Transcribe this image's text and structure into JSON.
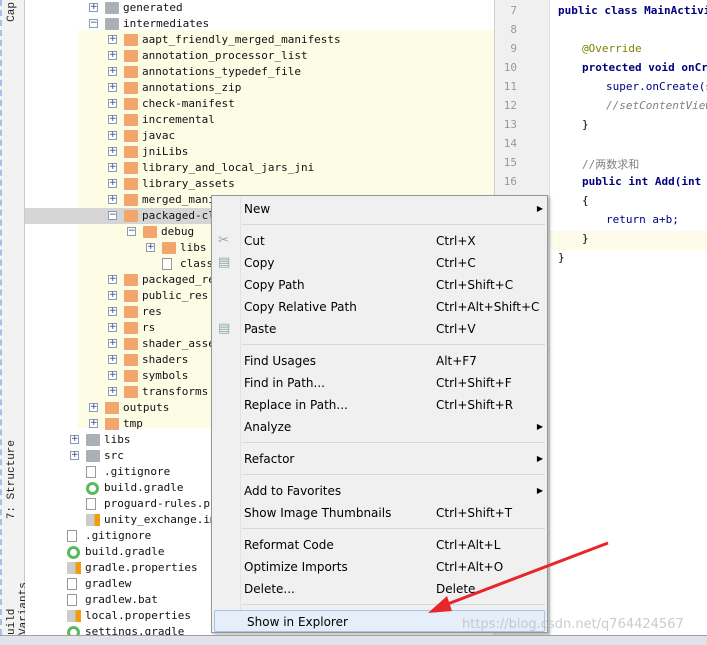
{
  "toolbar_strip": {
    "top_label": "Cap",
    "structure_label": "7: Structure",
    "variants_label": "uild Variants"
  },
  "tree": {
    "selected_index": 13,
    "highlight_color": "#fdfde6",
    "rows": [
      {
        "text": "generated",
        "level": 0,
        "icon": "folder-gray",
        "exp": "+"
      },
      {
        "text": "intermediates",
        "level": 0,
        "icon": "folder-gray",
        "exp": "-"
      },
      {
        "text": "aapt_friendly_merged_manifests",
        "level": 1,
        "icon": "folder-orange",
        "exp": "+"
      },
      {
        "text": "annotation_processor_list",
        "level": 1,
        "icon": "folder-orange",
        "exp": "+"
      },
      {
        "text": "annotations_typedef_file",
        "level": 1,
        "icon": "folder-orange",
        "exp": "+"
      },
      {
        "text": "annotations_zip",
        "level": 1,
        "icon": "folder-orange",
        "exp": "+"
      },
      {
        "text": "check-manifest",
        "level": 1,
        "icon": "folder-orange",
        "exp": "+"
      },
      {
        "text": "incremental",
        "level": 1,
        "icon": "folder-orange",
        "exp": "+"
      },
      {
        "text": "javac",
        "level": 1,
        "icon": "folder-orange",
        "exp": "+"
      },
      {
        "text": "jniLibs",
        "level": 1,
        "icon": "folder-orange",
        "exp": "+"
      },
      {
        "text": "library_and_local_jars_jni",
        "level": 1,
        "icon": "folder-orange",
        "exp": "+"
      },
      {
        "text": "library_assets",
        "level": 1,
        "icon": "folder-orange",
        "exp": "+"
      },
      {
        "text": "merged_mani",
        "level": 1,
        "icon": "folder-orange",
        "exp": "+"
      },
      {
        "text": "packaged-cl",
        "level": 1,
        "icon": "folder-orange",
        "exp": "-"
      },
      {
        "text": "debug",
        "level": 2,
        "icon": "folder-orange",
        "exp": "-"
      },
      {
        "text": "libs",
        "level": 3,
        "icon": "folder-orange",
        "exp": "+"
      },
      {
        "text": "class",
        "level": 3,
        "icon": "file",
        "exp": ""
      },
      {
        "text": "packaged_re",
        "level": 1,
        "icon": "folder-orange",
        "exp": "+"
      },
      {
        "text": "public_res",
        "level": 1,
        "icon": "folder-orange",
        "exp": "+"
      },
      {
        "text": "res",
        "level": 1,
        "icon": "folder-orange",
        "exp": "+"
      },
      {
        "text": "rs",
        "level": 1,
        "icon": "folder-orange",
        "exp": "+"
      },
      {
        "text": "shader_asse",
        "level": 1,
        "icon": "folder-orange",
        "exp": "+"
      },
      {
        "text": "shaders",
        "level": 1,
        "icon": "folder-orange",
        "exp": "+"
      },
      {
        "text": "symbols",
        "level": 1,
        "icon": "folder-orange",
        "exp": "+"
      },
      {
        "text": "transforms",
        "level": 1,
        "icon": "folder-orange",
        "exp": "+"
      },
      {
        "text": "outputs",
        "level": 0,
        "icon": "folder-orange",
        "exp": "+"
      },
      {
        "text": "tmp",
        "level": 0,
        "icon": "folder-orange",
        "exp": "+"
      },
      {
        "text": "libs",
        "level": -1,
        "icon": "folder-gray",
        "exp": "+"
      },
      {
        "text": "src",
        "level": -1,
        "icon": "folder-gray",
        "exp": "+"
      },
      {
        "text": ".gitignore",
        "level": -1,
        "icon": "file",
        "exp": ""
      },
      {
        "text": "build.gradle",
        "level": -1,
        "icon": "gradle",
        "exp": ""
      },
      {
        "text": "proguard-rules.pro",
        "level": -1,
        "icon": "file",
        "exp": ""
      },
      {
        "text": "unity_exchange.iml",
        "level": -1,
        "icon": "props",
        "exp": ""
      },
      {
        "text": ".gitignore",
        "level": -2,
        "icon": "file",
        "exp": ""
      },
      {
        "text": "build.gradle",
        "level": -2,
        "icon": "gradle",
        "exp": ""
      },
      {
        "text": "gradle.properties",
        "level": -2,
        "icon": "props",
        "exp": ""
      },
      {
        "text": "gradlew",
        "level": -2,
        "icon": "file",
        "exp": ""
      },
      {
        "text": "gradlew.bat",
        "level": -2,
        "icon": "file",
        "exp": ""
      },
      {
        "text": "local.properties",
        "level": -2,
        "icon": "props",
        "exp": ""
      },
      {
        "text": "settings.gradle",
        "level": -2,
        "icon": "gradle",
        "exp": ""
      }
    ]
  },
  "editor": {
    "lines": [
      {
        "num": "7",
        "indent": 0,
        "text": "public class MainActivi",
        "color": "#000080",
        "bold": true
      },
      {
        "num": "8",
        "indent": 0,
        "text": ""
      },
      {
        "num": "9",
        "indent": 1,
        "text": "@Override",
        "color": "#808000"
      },
      {
        "num": "10",
        "indent": 1,
        "text": "protected void onCr",
        "color": "#000080",
        "bold": true
      },
      {
        "num": "11",
        "indent": 2,
        "text": "super.onCreate(s",
        "color": "#000080"
      },
      {
        "num": "12",
        "indent": 2,
        "text": "//setContentView",
        "color": "#808080",
        "italic": true
      },
      {
        "num": "13",
        "indent": 1,
        "text": "}"
      },
      {
        "num": "14",
        "indent": 0,
        "text": ""
      },
      {
        "num": "15",
        "indent": 1,
        "text": "//两数求和",
        "color": "#808080"
      },
      {
        "num": "16",
        "indent": 1,
        "text": "public int Add(int",
        "color": "#000080",
        "bold": true
      },
      {
        "num": "",
        "indent": 1,
        "text": "{"
      },
      {
        "num": "",
        "indent": 2,
        "text": "return a+b;",
        "color": "#000080"
      },
      {
        "num": "",
        "indent": 1,
        "text": "}"
      },
      {
        "num": "",
        "indent": 0,
        "text": "}"
      }
    ]
  },
  "context_menu": {
    "items": [
      {
        "label": "New",
        "submenu": true
      },
      {
        "sep": true
      },
      {
        "label": "Cut",
        "shortcut": "Ctrl+X",
        "icon": "cut"
      },
      {
        "label": "Copy",
        "shortcut": "Ctrl+C",
        "icon": "copy"
      },
      {
        "label": "Copy Path",
        "shortcut": "Ctrl+Shift+C"
      },
      {
        "label": "Copy Relative Path",
        "shortcut": "Ctrl+Alt+Shift+C"
      },
      {
        "label": "Paste",
        "shortcut": "Ctrl+V",
        "icon": "paste"
      },
      {
        "sep": true
      },
      {
        "label": "Find Usages",
        "shortcut": "Alt+F7"
      },
      {
        "label": "Find in Path...",
        "shortcut": "Ctrl+Shift+F"
      },
      {
        "label": "Replace in Path...",
        "shortcut": "Ctrl+Shift+R"
      },
      {
        "label": "Analyze",
        "submenu": true
      },
      {
        "sep": true
      },
      {
        "label": "Refactor",
        "submenu": true
      },
      {
        "sep": true
      },
      {
        "label": "Add to Favorites",
        "submenu": true
      },
      {
        "label": "Show Image Thumbnails",
        "shortcut": "Ctrl+Shift+T"
      },
      {
        "sep": true
      },
      {
        "label": "Reformat Code",
        "shortcut": "Ctrl+Alt+L"
      },
      {
        "label": "Optimize Imports",
        "shortcut": "Ctrl+Alt+O"
      },
      {
        "label": "Delete...",
        "shortcut": "Delete"
      },
      {
        "sep": true
      },
      {
        "label": "Show in Explorer",
        "highlighted": true
      }
    ]
  },
  "annotation": {
    "arrow_color": "#e8262a"
  },
  "watermark": "https://blog.csdn.net/q764424567"
}
